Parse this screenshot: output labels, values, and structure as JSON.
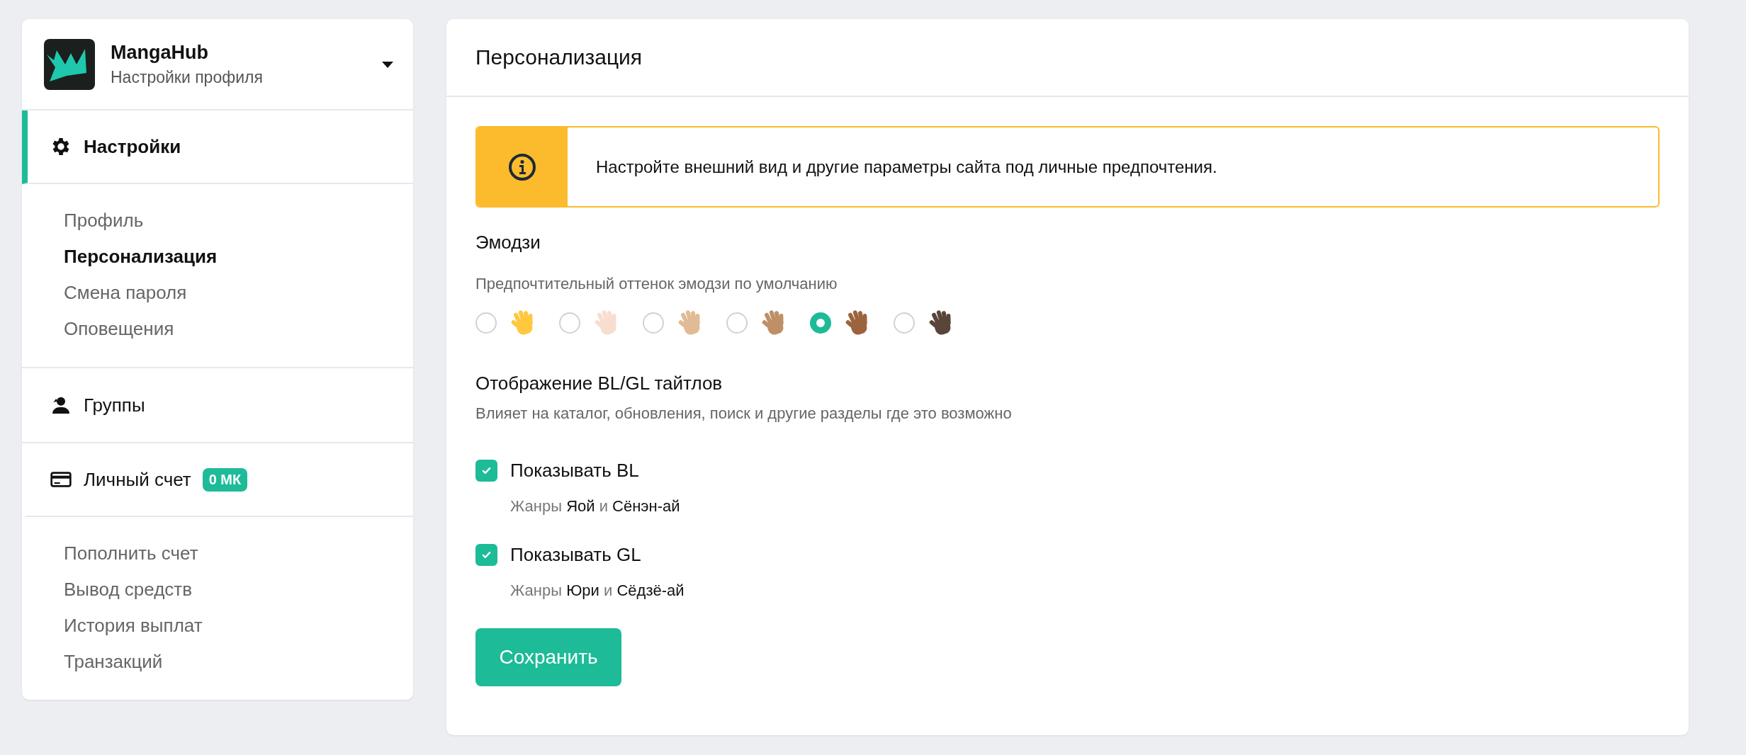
{
  "sidebar": {
    "brand": {
      "name": "MangaHub",
      "subtitle": "Настройки профиля"
    },
    "groups": [
      {
        "label": "Настройки",
        "selected": true,
        "items": [
          {
            "label": "Профиль",
            "selected": false
          },
          {
            "label": "Персонализация",
            "selected": true
          },
          {
            "label": "Смена пароля",
            "selected": false
          },
          {
            "label": "Оповещения",
            "selected": false
          }
        ]
      },
      {
        "label": "Группы",
        "selected": false
      },
      {
        "label": "Личный счет",
        "selected": false,
        "badge": "0 МК",
        "items": [
          {
            "label": "Пополнить счет",
            "selected": false
          },
          {
            "label": "Вывод средств",
            "selected": false
          },
          {
            "label": "История выплат",
            "selected": false
          },
          {
            "label": "Транзакций",
            "selected": false
          }
        ]
      }
    ]
  },
  "panel": {
    "title": "Персонализация",
    "alert": "Настройте внешний вид и другие параметры сайта под личные предпочтения.",
    "emoji": {
      "title": "Эмодзи",
      "subtitle": "Предпочтительный оттенок эмодзи по умолчанию",
      "options": [
        {
          "color": "#ffc83d",
          "selected": false
        },
        {
          "color": "#f7dece",
          "selected": false
        },
        {
          "color": "#e0bb95",
          "selected": false
        },
        {
          "color": "#bf8f68",
          "selected": false
        },
        {
          "color": "#9b643d",
          "selected": true
        },
        {
          "color": "#594539",
          "selected": false
        }
      ]
    },
    "titles": {
      "title": "Отображение BL/GL тайтлов",
      "description": "Влияет на каталог, обновления, поиск и другие разделы где это возможно",
      "options": [
        {
          "label": "Показывать BL",
          "checked": true,
          "genres": [
            {
              "text": "Жанры",
              "kind": "muted"
            },
            {
              "text": "Яой",
              "kind": "genre"
            },
            {
              "text": "и",
              "kind": "muted"
            },
            {
              "text": "Сёнэн-ай",
              "kind": "genre"
            }
          ]
        },
        {
          "label": "Показывать GL",
          "checked": true,
          "genres": [
            {
              "text": "Жанры",
              "kind": "muted"
            },
            {
              "text": "Юри",
              "kind": "genre"
            },
            {
              "text": "и",
              "kind": "muted"
            },
            {
              "text": "Сёдзё-ай",
              "kind": "genre"
            }
          ]
        }
      ]
    },
    "save_button": "Сохранить"
  }
}
